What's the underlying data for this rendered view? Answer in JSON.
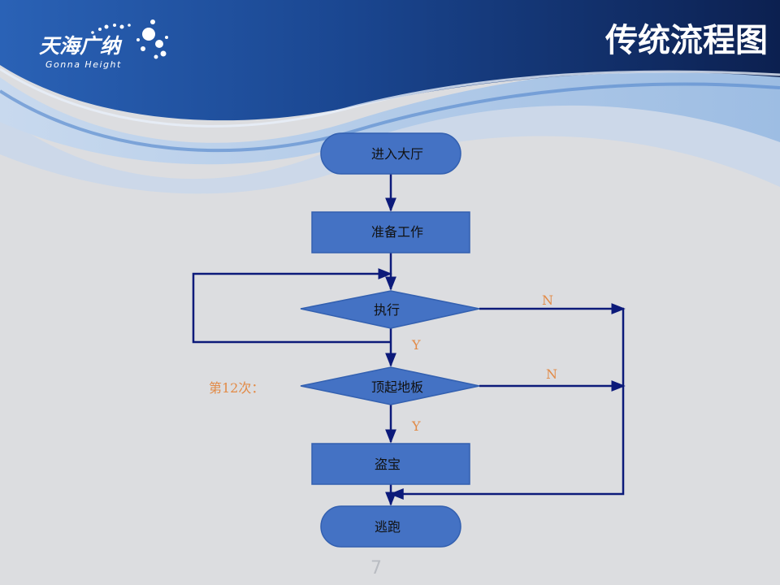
{
  "header": {
    "brand_cn": "天海广纳",
    "brand_en": "Gonna Height",
    "title": "传统流程图"
  },
  "flowchart": {
    "nodes": {
      "start": "进入大厅",
      "prepare": "准备工作",
      "execute": "执行",
      "lift_floor": "顶起地板",
      "steal": "盗宝",
      "escape": "逃跑"
    },
    "edge_labels": {
      "execute_no": "N",
      "execute_yes": "Y",
      "lift_no": "N",
      "lift_yes": "Y"
    },
    "annotation": "第12次："
  },
  "footer": {
    "page_number": "7"
  },
  "colors": {
    "header_dark": "#0d2456",
    "header_mid": "#1c4d9a",
    "header_light": "#2f6dbd",
    "wave_light": "#a8c6e6",
    "wave_mid": "#7fa6d6",
    "background": "#dcdde0",
    "node_fill": "#4472c4",
    "node_stroke": "#3360b0",
    "connector": "#0c1a7a",
    "label_orange": "#e28a46"
  }
}
